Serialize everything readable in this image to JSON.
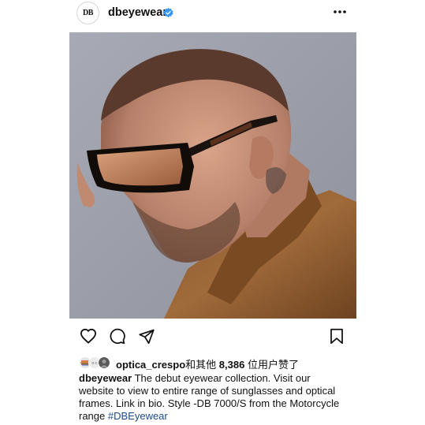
{
  "header": {
    "avatar_text": "DB",
    "username": "dbeyewear"
  },
  "icons": {
    "verified": "verified-badge-icon",
    "more": "more-options-icon",
    "like": "heart-icon",
    "comment": "comment-icon",
    "share": "send-icon",
    "save": "bookmark-icon"
  },
  "likes": {
    "first_user": "optica_crespo",
    "rest_prefix": "和其他 ",
    "count": "8,386",
    "rest_suffix": " 位用户赞了"
  },
  "caption": {
    "username": "dbeyewear",
    "text": " The debut eyewear collection. Visit our website to view to entire range of sunglasses and optical frames. Link in bio. Style -DB 7000/S from the Motorcycle range ",
    "hashtag": "#DBEyewear"
  },
  "colors": {
    "verified_blue": "#3897f0",
    "hashtag": "#1a4b8c",
    "text": "#111111"
  }
}
